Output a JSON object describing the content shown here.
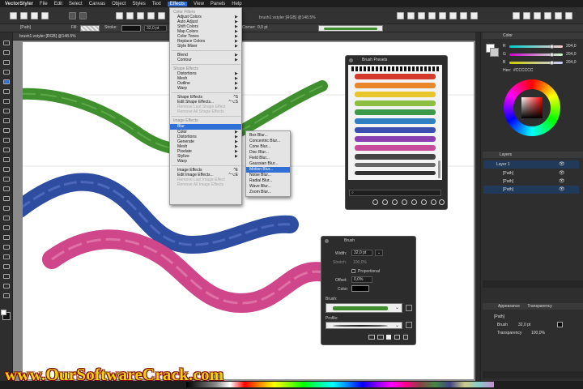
{
  "menubar": {
    "app": "VectorStyler",
    "items": [
      "File",
      "Edit",
      "Select",
      "Canvas",
      "Object",
      "Styles",
      "Text",
      "Effects",
      "View",
      "Panels",
      "Help"
    ],
    "active": "Effects"
  },
  "window_title": "brush1.vstyler [RGB] @148.5%",
  "toolbar2": {
    "selection": "[Path]",
    "fill_label": "Fill:",
    "stroke_label": "Stroke:",
    "stroke_value": "32,0 pt",
    "corner_label": "Corner:",
    "corner_value": "0,0 pt"
  },
  "doc_tab": "brush1.vstyler [RGB] @148.5%",
  "effects_menu": {
    "items": [
      {
        "label": "Color Filters",
        "kind": "hdr"
      },
      {
        "label": "Adjust Colors",
        "kind": "sub"
      },
      {
        "label": "Auto Adjust",
        "kind": "sub"
      },
      {
        "label": "Shift Colors",
        "kind": "sub"
      },
      {
        "label": "Map Colors",
        "kind": "sub"
      },
      {
        "label": "Color Tones",
        "kind": "sub"
      },
      {
        "label": "Replace Colors",
        "kind": "sub"
      },
      {
        "label": "Style Mixer",
        "kind": "sub"
      },
      {
        "kind": "sep"
      },
      {
        "label": "Blend",
        "kind": "sub"
      },
      {
        "label": "Contour",
        "kind": "sub"
      },
      {
        "kind": "sep"
      },
      {
        "label": "Shape Effects",
        "kind": "hdr"
      },
      {
        "label": "Distortions",
        "kind": "sub"
      },
      {
        "label": "Mesh",
        "kind": "sub"
      },
      {
        "label": "Outline",
        "kind": "sub"
      },
      {
        "label": "Warp",
        "kind": "sub"
      },
      {
        "kind": "sep"
      },
      {
        "label": "Shape Effects",
        "kind": "item",
        "shortcut": "^S"
      },
      {
        "label": "Edit Shape Effects...",
        "kind": "item",
        "shortcut": "^⌥S"
      },
      {
        "label": "Remove Last Shape Effect",
        "kind": "dis"
      },
      {
        "label": "Remove All Shape Effects",
        "kind": "dis"
      },
      {
        "kind": "sep"
      },
      {
        "label": "Image Effects",
        "kind": "hdr"
      },
      {
        "label": "Blur",
        "kind": "sel"
      },
      {
        "label": "Color",
        "kind": "sub"
      },
      {
        "label": "Distortions",
        "kind": "sub"
      },
      {
        "label": "Generate",
        "kind": "sub"
      },
      {
        "label": "Mesh",
        "kind": "sub"
      },
      {
        "label": "Pixelate",
        "kind": "sub"
      },
      {
        "label": "Stylize",
        "kind": "sub"
      },
      {
        "label": "Warp",
        "kind": "sub"
      },
      {
        "kind": "sep"
      },
      {
        "label": "Image Effects",
        "kind": "item",
        "shortcut": "^E"
      },
      {
        "label": "Edit Image Effects...",
        "kind": "item",
        "shortcut": "^⌥E"
      },
      {
        "label": "Remove Last Image Effect",
        "kind": "dis"
      },
      {
        "label": "Remove All Image Effects",
        "kind": "dis"
      }
    ]
  },
  "blur_submenu": {
    "items": [
      "Box Blur...",
      "Concentric Blur...",
      "Cone Blur...",
      "Disc Blur...",
      "Field Blur...",
      "Gaussian Blur...",
      "Motion Blur...",
      "Noise Blur...",
      "Radial Blur...",
      "Wave Blur...",
      "Zoom Blur..."
    ],
    "selected": "Motion Blur..."
  },
  "brush_presets": {
    "title": "Brush Presets",
    "colors": [
      "#222222",
      "#d33a2c",
      "#e9862a",
      "#e8c52a",
      "#8cbf3f",
      "#3b9a4a",
      "#2f7fc1",
      "#3a4fb0",
      "#8a3fb0",
      "#c74b9b",
      "#444444",
      "#666666",
      "#333333"
    ]
  },
  "brush_panel": {
    "title": "Brush",
    "width_label": "Width:",
    "width_value": "32,0 pt",
    "stretch_label": "Stretch:",
    "stretch_value": "100,0%",
    "proportional_label": "Proportional",
    "offset_label": "Offset:",
    "offset_value": "0,0%",
    "color_label": "Color:",
    "brush_label": "Brush:",
    "profile_label": "Profile:"
  },
  "color_panel": {
    "title": "Color",
    "r_label": "R",
    "g_label": "G",
    "b_label": "B",
    "r_value": "204,0",
    "g_value": "204,0",
    "b_value": "204,0",
    "hex_label": "Hex:",
    "hex_value": "#CCCCCC"
  },
  "layers_panel": {
    "title": "Layers",
    "rows": [
      "Layer 1",
      "[Path]",
      "[Path]",
      "[Path]"
    ]
  },
  "appearance_panel": {
    "tab1": "Appearance",
    "tab2": "Transparency",
    "path_label": "[Path]",
    "brush_label": "Brush",
    "brush_value": "32,0 pt",
    "transparency_label": "Transparency",
    "transparency_value": "100,0%"
  },
  "watermark": "www.OurSoftwareCrack.com",
  "colors": {
    "green_stroke": "#3f8f2f",
    "blue_stroke": "#2f4da0",
    "pink_stroke": "#d0468a",
    "menu_highlight": "#2f6fd6"
  }
}
